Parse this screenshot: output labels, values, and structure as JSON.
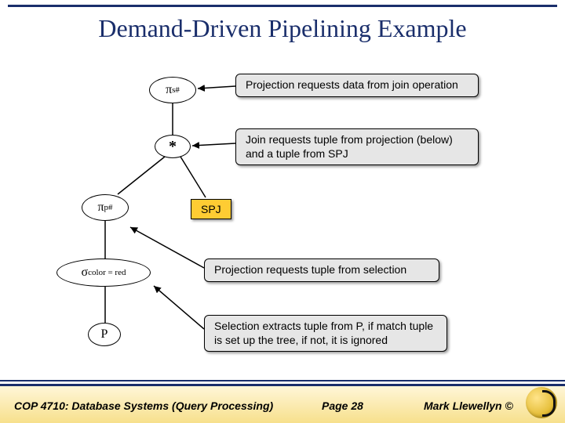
{
  "title": "Demand-Driven Pipelining Example",
  "nodes": {
    "pi_s": {
      "sym": "π",
      "sub": "s#"
    },
    "join": "*",
    "pi_p": {
      "sym": "π",
      "sub": "p#"
    },
    "sigma": {
      "sym": "σ",
      "sub": "color = red"
    },
    "p": "P",
    "spj": "SPJ"
  },
  "annotations": {
    "a1": "Projection requests data from join operation",
    "a2": "Join requests tuple from projection (below) and a tuple from SPJ",
    "a3": "Projection requests tuple from selection",
    "a4": "Selection extracts tuple from P, if match tuple is set up the tree, if not, it is ignored"
  },
  "footer": {
    "course": "COP 4710: Database Systems (Query Processing)",
    "page": "Page 28",
    "author": "Mark Llewellyn ©"
  }
}
